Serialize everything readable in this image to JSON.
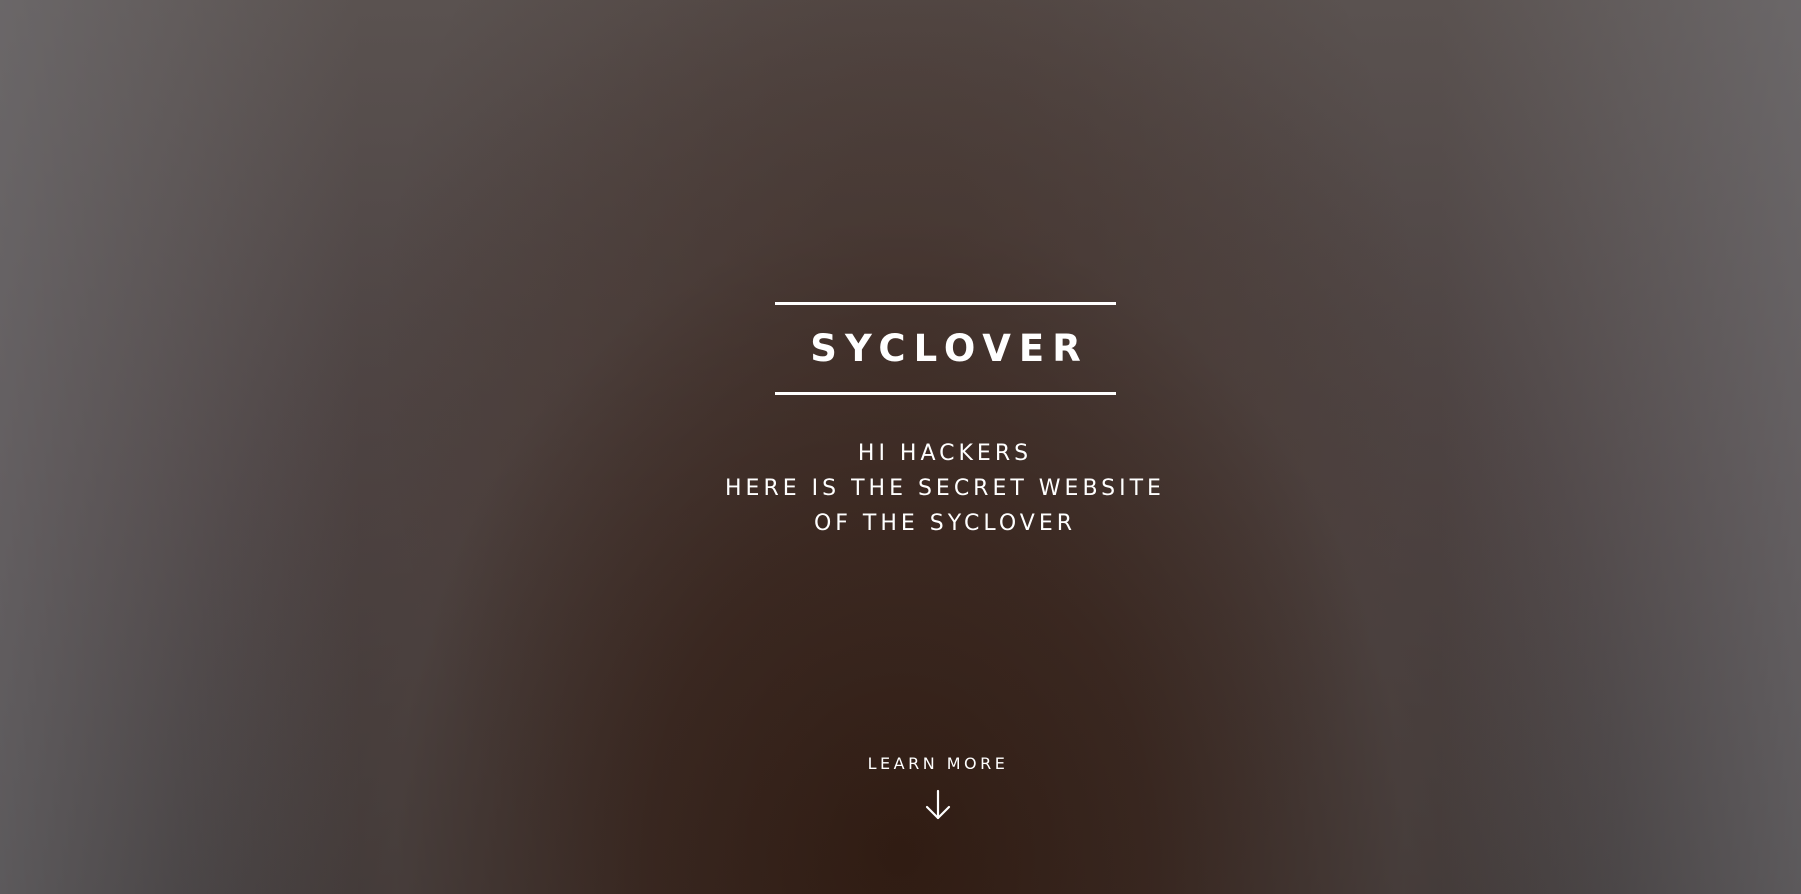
{
  "hero": {
    "title": "SYCLOVER",
    "subtitle_lines": [
      "HI HACKERS",
      "HERE IS THE SECRET WEBSITE",
      "OF THE SYCLOVER"
    ],
    "learn_more": "LEARN MORE",
    "learn_more_icon": "arrow-down-icon"
  },
  "colors": {
    "text": "#ffffff",
    "background_center": "#2d180e",
    "background_edge": "#6e6c6e"
  }
}
